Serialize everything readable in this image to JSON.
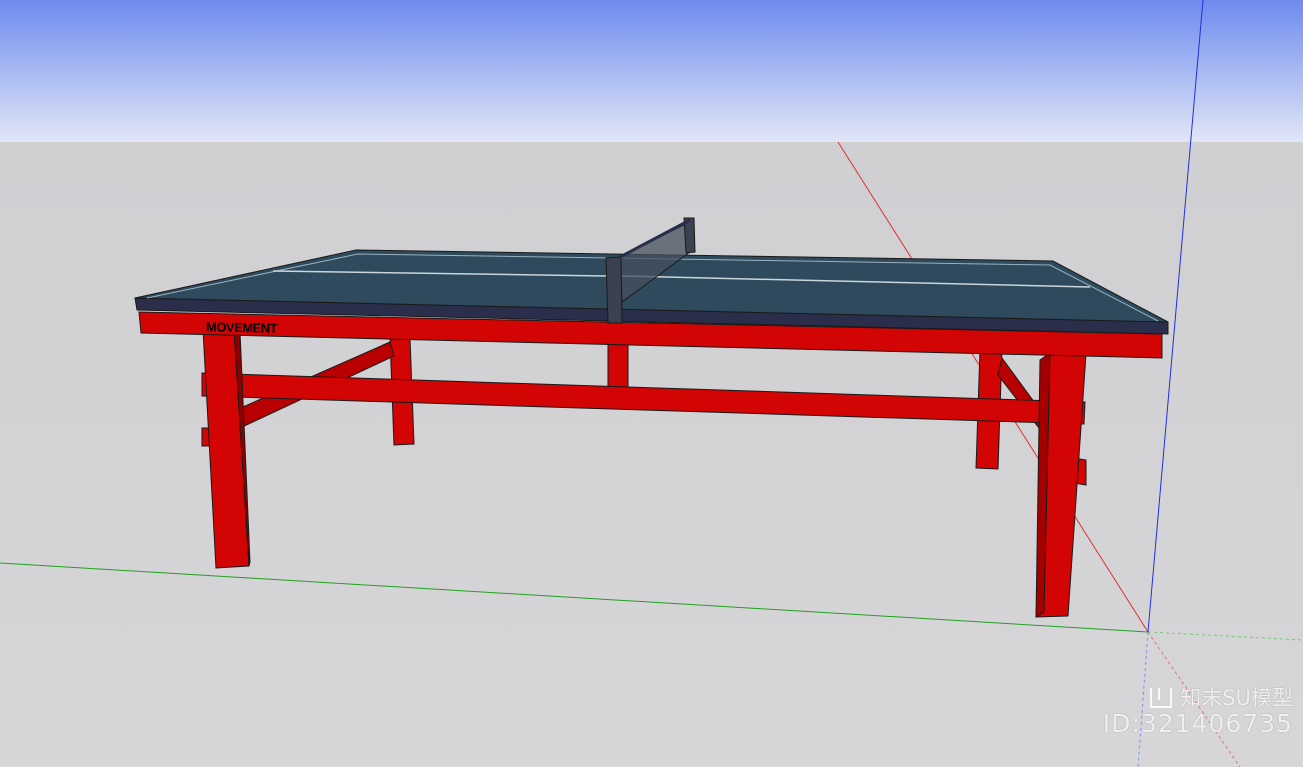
{
  "scene": {
    "brand_text": "MOVEMENT",
    "colors": {
      "sky_top": "#6E8BEF",
      "sky_bottom": "#DDE3F7",
      "ground": "#D2D2D5",
      "table_top": "#2E4A5C",
      "table_edge": "#2A2E4A",
      "frame_red": "#D20404",
      "frame_shadow": "#8E0000",
      "net": "#3B4150",
      "axis_red": "#E03030",
      "axis_green": "#20A020",
      "axis_blue": "#2030E0"
    }
  },
  "watermark": {
    "logo_icon": "zhimo-logo-icon",
    "brand": "知末SU模型",
    "id_text": "ID:321406735"
  }
}
